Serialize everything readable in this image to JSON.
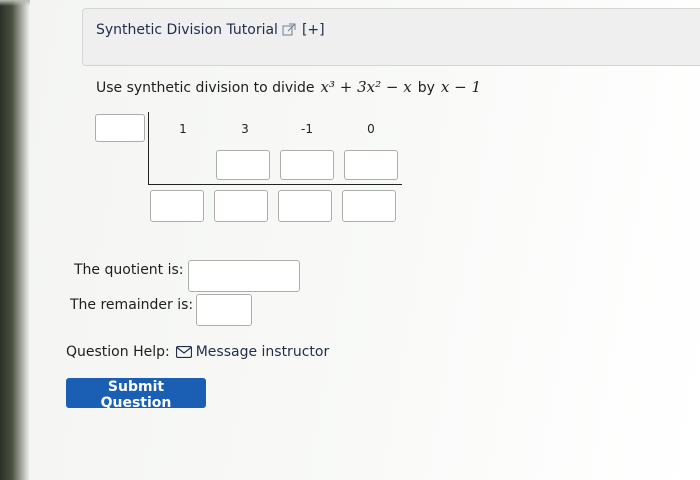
{
  "header": {
    "tutorial_label": "Synthetic Division Tutorial",
    "expand_label": "[+]",
    "icon": "external-link-icon"
  },
  "problem": {
    "prefix": "Use synthetic division to divide",
    "dividend": "x³ + 3x² − x",
    "by_word": "by",
    "divisor": "x − 1"
  },
  "synthetic": {
    "divisor_value": "",
    "coefficients": [
      "1",
      "3",
      "-1",
      "0"
    ],
    "middle_row": [
      "",
      "",
      ""
    ],
    "bottom_row": [
      "",
      "",
      "",
      ""
    ]
  },
  "answers": {
    "quotient_label": "The quotient is:",
    "quotient_value": "",
    "remainder_label": "The remainder is:",
    "remainder_value": ""
  },
  "help": {
    "label": "Question Help:",
    "message_label": "Message instructor",
    "icon": "mail-icon"
  },
  "submit": {
    "label": "Submit Question"
  },
  "colors": {
    "accent": "#1a5fb4",
    "link": "#1f2d4a",
    "box_border": "#a9b0aa"
  }
}
